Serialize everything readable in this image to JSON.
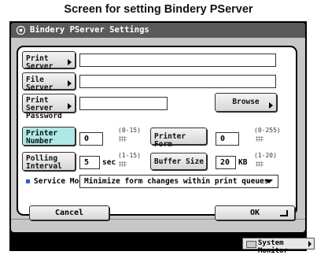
{
  "caption": "Screen for setting Bindery PServer",
  "window": {
    "title": "Bindery PServer Settings"
  },
  "rows": {
    "print_server": {
      "label": "Print Server",
      "value": ""
    },
    "file_server": {
      "label": "File Server",
      "value": ""
    },
    "password": {
      "label_line1": "Print Server",
      "label_line2": "Password",
      "value": "",
      "browse_label": "Browse"
    },
    "printer_number": {
      "label_line1": "Printer",
      "label_line2": "Number",
      "value": "0",
      "range": "(0-15)"
    },
    "printer_form": {
      "label": "Printer Form",
      "value": "0",
      "range": "(0-255)"
    },
    "polling_interval": {
      "label_line1": "Polling",
      "label_line2": "Interval",
      "value": "5",
      "unit": "sec",
      "range": "(1-15)"
    },
    "buffer_size": {
      "label": "Buffer Size",
      "value": "20",
      "unit": "KB",
      "range": "(1-20)"
    },
    "service_mode": {
      "label": "Service Mode",
      "value": "Minimize form changes within print queues"
    }
  },
  "buttons": {
    "cancel": "Cancel",
    "ok": "OK"
  },
  "system_monitor": "System Monitor",
  "colors": {
    "highlight": "#aee9e7",
    "titlebar": "#5a5a5a",
    "bullet": "#2a5bd7"
  }
}
